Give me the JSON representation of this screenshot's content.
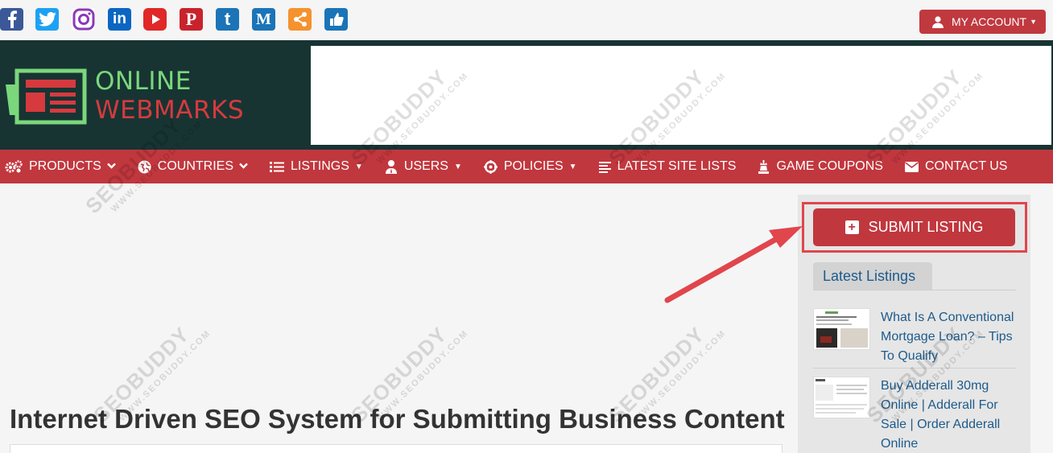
{
  "social": [
    {
      "icon": "facebook-icon",
      "color": "#3b5998",
      "glyph": "f"
    },
    {
      "icon": "twitter-icon",
      "color": "#1da1f2",
      "glyph": ""
    },
    {
      "icon": "instagram-icon",
      "color": "#8a3ab9",
      "glyph": ""
    },
    {
      "icon": "linkedin-icon",
      "color": "#0a66c2",
      "glyph": "in"
    },
    {
      "icon": "youtube-icon",
      "color": "#e02828",
      "glyph": ""
    },
    {
      "icon": "pinterest-icon",
      "color": "#c8232c",
      "glyph": "P"
    },
    {
      "icon": "tumblr-icon",
      "color": "#1b74b7",
      "glyph": "t"
    },
    {
      "icon": "medium-icon",
      "color": "#1b74b7",
      "glyph": "M"
    },
    {
      "icon": "share-icon",
      "color": "#f5922f",
      "glyph": ""
    },
    {
      "icon": "like-icon",
      "color": "#1b74b7",
      "glyph": ""
    }
  ],
  "account": {
    "label": "MY ACCOUNT",
    "icon": "user-icon"
  },
  "logo": {
    "line1": "ONLINE",
    "line2": "WEBMARKS"
  },
  "nav": [
    {
      "label": "PRODUCTS",
      "icon": "cogs-icon",
      "caret": "chevron"
    },
    {
      "label": "COUNTRIES",
      "icon": "globe-icon",
      "caret": "chevron"
    },
    {
      "label": "LISTINGS",
      "icon": "list-icon",
      "caret": "triangle"
    },
    {
      "label": "USERS",
      "icon": "user-tie-icon",
      "caret": "triangle"
    },
    {
      "label": "POLICIES",
      "icon": "crosshair-icon",
      "caret": "triangle"
    },
    {
      "label": "LATEST SITE LISTS",
      "icon": "lines-icon",
      "caret": ""
    },
    {
      "label": "GAME COUPONS",
      "icon": "chess-icon",
      "caret": ""
    },
    {
      "label": "CONTACT US",
      "icon": "envelope-icon",
      "caret": ""
    }
  ],
  "main": {
    "title": "Internet Driven SEO System for Submitting Business Content"
  },
  "sidebar": {
    "submit_label": "SUBMIT LISTING",
    "tab_label": "Latest Listings",
    "listings": [
      {
        "title": "What Is A Conventional Mortgage Loan? – Tips To Qualify"
      },
      {
        "title": "Buy Adderall 30mg Online | Adderall For Sale | Order Adderall Online"
      }
    ]
  },
  "watermark": {
    "text": "SEOBUDDY",
    "sub": "WWW.SEOBUDDY.COM"
  },
  "colors": {
    "brand_red": "#c1373e",
    "header_dark": "#173433",
    "link_blue": "#1d5b8c",
    "arrow_red": "#e0464c"
  }
}
